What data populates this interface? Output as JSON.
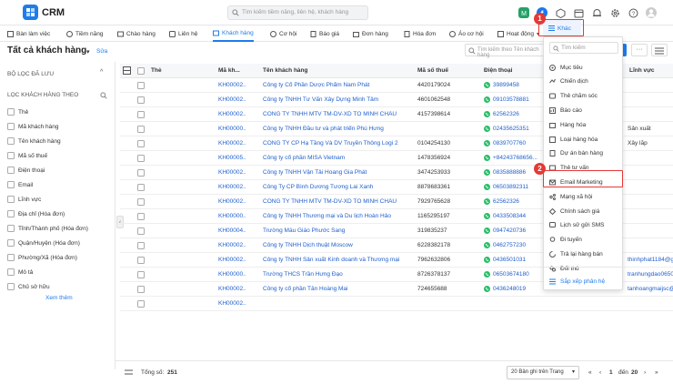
{
  "app": {
    "name": "CRM"
  },
  "search": {
    "placeholder": "Tìm kiếm tiềm năng, liên hệ, khách hàng"
  },
  "nav": {
    "items": [
      {
        "label": "Bàn làm việc"
      },
      {
        "label": "Tiềm năng"
      },
      {
        "label": "Chào hàng"
      },
      {
        "label": "Liên hệ"
      },
      {
        "label": "Khách hàng"
      },
      {
        "label": "Cơ hội"
      },
      {
        "label": "Báo giá"
      },
      {
        "label": "Đơn hàng"
      },
      {
        "label": "Hóa đơn"
      },
      {
        "label": "Áo cơ hội"
      },
      {
        "label": "Hoạt động"
      }
    ],
    "active": "Khách hàng"
  },
  "page": {
    "title": "Tất cả khách hàng",
    "edit_label": "Sửa",
    "grid_search_placeholder": "Tìm kiếm theo Tên khách hàng"
  },
  "sidebar": {
    "saved_filter_heading": "BỘ LỌC ĐÃ LƯU",
    "filter_heading": "LỌC KHÁCH HÀNG THEO",
    "filters": [
      "Thẻ",
      "Mã khách hàng",
      "Tên khách hàng",
      "Mã số thuế",
      "Điện thoại",
      "Email",
      "Lĩnh vực",
      "Địa chỉ (Hóa đơn)",
      "Tỉnh/Thành phố (Hóa đơn)",
      "Quận/Huyện (Hóa đơn)",
      "Phường/Xã (Hóa đơn)",
      "Mô tả",
      "Chủ sở hữu"
    ],
    "more_label": "Xem thêm"
  },
  "table": {
    "headers": {
      "tag": "Thẻ",
      "code": "Mã kh...",
      "name": "Tên khách hàng",
      "tax": "Mã số thuế",
      "phone": "Điện thoại",
      "field": "Lĩnh vực"
    },
    "rows": [
      {
        "code": "KH00002...",
        "name": "Công ty Cổ Phần Dược Phẩm Nam Phát",
        "tax": "4420179024",
        "phone": "39899458",
        "extra": ""
      },
      {
        "code": "KH00002...",
        "name": "Công ty TNHH Tư Vấn Xây Dựng Minh Tâm",
        "tax": "4601062548",
        "phone": "09103578881",
        "extra": ""
      },
      {
        "code": "KH00002...",
        "name": "CÔNG TY TNHH MTV TM-DV-XD TÔ MINH CHÂU",
        "tax": "4157398614",
        "phone": "62562326",
        "extra": ""
      },
      {
        "code": "KH00000...",
        "name": "Công ty TNHH Đầu tư và phát triển Phú Hưng",
        "tax": "",
        "phone": "02435625351",
        "extra": "Sản xuất"
      },
      {
        "code": "KH00002...",
        "name": "CÔNG TY CP Hạ Tầng Và DV Truyền Thông Logi 2",
        "tax": "0104254130",
        "phone": "0839707760",
        "extra": "Xây lắp"
      },
      {
        "code": "KH00005...",
        "name": "Công ty cổ phần MISA Vietnam",
        "tax": "1478356924",
        "phone": "+84243768656...",
        "extra": ""
      },
      {
        "code": "KH00002...",
        "name": "Công ty TNHH Vận Tải Hoang Gia Phát",
        "tax": "3474253933",
        "phone": "0835888886",
        "extra": ""
      },
      {
        "code": "KH00002...",
        "name": "Công Ty CP Bình Dương Tương Lai Xanh",
        "tax": "8878683361",
        "phone": "06503892311",
        "extra": ""
      },
      {
        "code": "KH00002...",
        "name": "CÔNG TY TNHH MTV TM-DV-XD TÔ MINH CHÂU",
        "tax": "7929765628",
        "phone": "62562326",
        "extra": ""
      },
      {
        "code": "KH00000...",
        "name": "Công ty TNHH Thương mại và Du lịch Hoàn Hảo",
        "tax": "1165295197",
        "phone": "0433508344",
        "extra": ""
      },
      {
        "code": "KH00004...",
        "name": "Trường Mẫu Giáo Phước Sang",
        "tax": "319835237",
        "phone": "0947420736",
        "extra": ""
      },
      {
        "code": "KH00002...",
        "name": "Công ty TNHH Dịch thuật Moscow",
        "tax": "6228382178",
        "phone": "0462757230",
        "extra": ""
      },
      {
        "code": "KH00002...",
        "name": "Công ty TNHH Sản xuất Kinh doanh và Thương mại T...",
        "tax": "7962632806",
        "phone": "0436501031",
        "extra": "thinhphat1184@gmail.com"
      },
      {
        "code": "KH00000...",
        "name": "Trường THCS Trần Hưng Đạo",
        "tax": "8726378137",
        "phone": "06503674180",
        "extra": "tranhungdao06503674180"
      },
      {
        "code": "KH00002...",
        "name": "Công ty cổ phần Tân Hoàng Mai",
        "tax": "724655688",
        "phone": "0436248019",
        "extra": "tanhoangmaijsc@gmail.com"
      },
      {
        "code": "KH00002...",
        "name": "",
        "tax": "",
        "phone": "",
        "extra": ""
      }
    ]
  },
  "footer": {
    "total_label": "Tổng số:",
    "total": "251",
    "page_size": "20 Bản ghi trên Trang",
    "range_from": "1",
    "range_to_label": "đến",
    "range_to": "20"
  },
  "menu": {
    "trigger_label": "Khác",
    "search_placeholder": "Tìm kiếm",
    "items": [
      "Mục tiêu",
      "Chiến dịch",
      "Thẻ chăm sóc",
      "Báo cáo",
      "Hàng hóa",
      "Loại hàng hóa",
      "Dự án bán hàng",
      "Thẻ tư vấn",
      "Email Marketing",
      "Mạng xã hội",
      "Chính sách giá",
      "Lịch sử gửi SMS",
      "Đi tuyến",
      "Trả lại hàng bán",
      "Đối thủ"
    ],
    "arrange_label": "Sắp xếp phân hệ"
  },
  "badges": {
    "one": "1",
    "two": "2"
  },
  "colors": {
    "accent": "#1f7ce8",
    "highlight": "#e53935",
    "phone": "#2bbd6b"
  }
}
